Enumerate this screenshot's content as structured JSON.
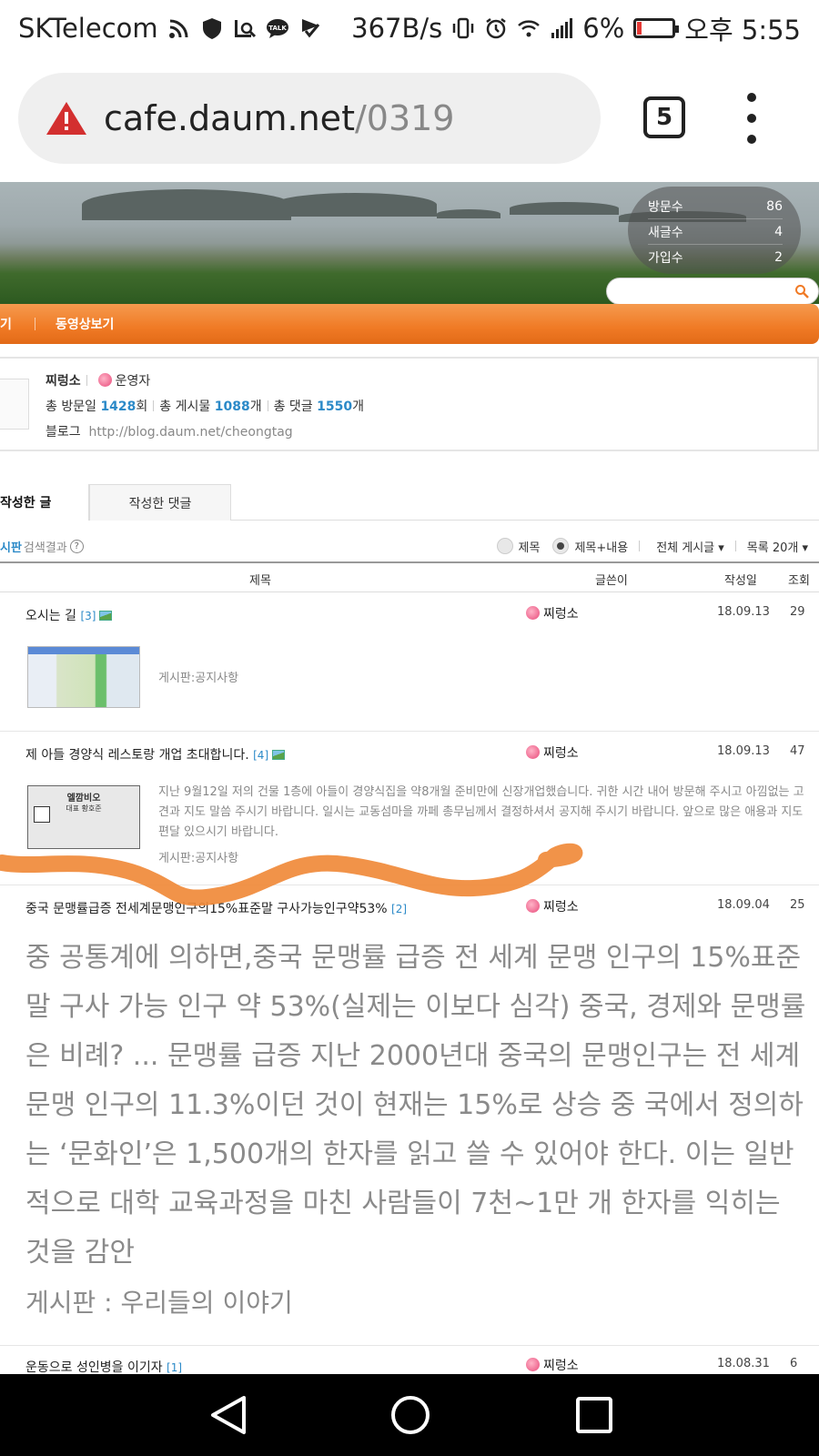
{
  "status_bar": {
    "carrier": "SKTelecom",
    "net_speed": "367B/s",
    "battery_pct": "6%",
    "battery_level": 0.06,
    "time": "오후 5:55",
    "icons": [
      "rss-icon",
      "shield-icon",
      "chart-search-icon",
      "talk-icon",
      "check-flag-icon",
      "vibrate-icon",
      "alarm-icon",
      "wifi-icon",
      "signal-icon",
      "battery-icon"
    ]
  },
  "browser": {
    "url_host": "cafe.daum.net",
    "url_path": "/0319",
    "tab_count": "5",
    "warning_color": "#d32f2f"
  },
  "cafe_stats": {
    "visitors_label": "방문수",
    "visitors": "86",
    "new_posts_label": "새글수",
    "new_posts": "4",
    "joins_label": "가입수",
    "joins": "2"
  },
  "nav": {
    "cut_item": "기",
    "video_item": "동영상보기",
    "accent": "#f07a25"
  },
  "profile": {
    "name": "찌렁소",
    "role": "운영자",
    "visits_label": "총 방문일",
    "visits": "1428",
    "visits_unit": "회",
    "posts_label": "총 게시물",
    "posts": "1088",
    "posts_unit": "개",
    "comments_label": "총 댓글",
    "comments": "1550",
    "comments_unit": "개",
    "blog_label": "블로그",
    "blog_url": "http://blog.daum.net/cheongtag"
  },
  "tabs": {
    "written_posts": "작성한 글",
    "written_comments": "작성한 댓글"
  },
  "search_opts": {
    "board": "시판",
    "results": "검색결과",
    "help": "?",
    "opt_title": "제목",
    "opt_title_content": "제목+내용",
    "all_posts": "전체 게시글 ▾",
    "list_count": "목록 20개 ▾"
  },
  "table_header": {
    "title": "제목",
    "author": "글쓴이",
    "date": "작성일",
    "views": "조회"
  },
  "posts": [
    {
      "title": "오시는 길",
      "count": "[3]",
      "author": "찌렁소",
      "date": "18.09.13",
      "views": "29",
      "meta": "게시판:공지사항"
    },
    {
      "title": "제 아들 경양식 레스토랑 개업 초대합니다.",
      "count": "[4]",
      "author": "찌렁소",
      "date": "18.09.13",
      "views": "47",
      "excerpt": "지난 9월12일 저의 건물 1층에 아들이 경양식집을 약8개월 준비만에 신장개업했습니다. 귀한 시간 내어 방문해 주시고 아낌없는 고견과 지도 말씀 주시기 바랍니다. 일시는 교동섬마을 까페 총무님께서 결정하셔서 공지해 주시기 바랍니다. 앞으로 많은 애용과 지도 편달 있으시기 바랍니다.",
      "meta": "게시판:공지사항",
      "thumb_name": "엘깜비오",
      "thumb_sub": "대표 황호준"
    },
    {
      "title": "중국 문맹률급증 전세계문맹인구의15%표준말 구사가능인구약53%",
      "count": "[2]",
      "author": "찌렁소",
      "date": "18.09.04",
      "views": "25",
      "excerpt": "중 공통계에 의하면,중국 문맹률 급증 전 세계 문맹 인구의 15%표준말 구사 가능 인구 약 53%(실제는 이보다 심각) 중국, 경제와 문맹률은 비례? ... 문맹률 급증 지난 2000년대 중국의 문맹인구는 전 세계 문맹 인구의 11.3%이던 것이 현재는 15%로 상승 중 국에서 정의하는 ‘문화인’은 1,500개의 한자를 읽고 쓸 수 있어야 한다. 이는 일반적으로 대학 교육과정을 마친 사람들이 7천~1만 개 한자를 익히는 것을 감안",
      "meta": "게시판 : 우리들의 이야기"
    },
    {
      "title": "운동으로 성인병을 이기자",
      "count": "[1]",
      "author": "찌렁소",
      "date": "18.08.31",
      "views": "6"
    }
  ]
}
